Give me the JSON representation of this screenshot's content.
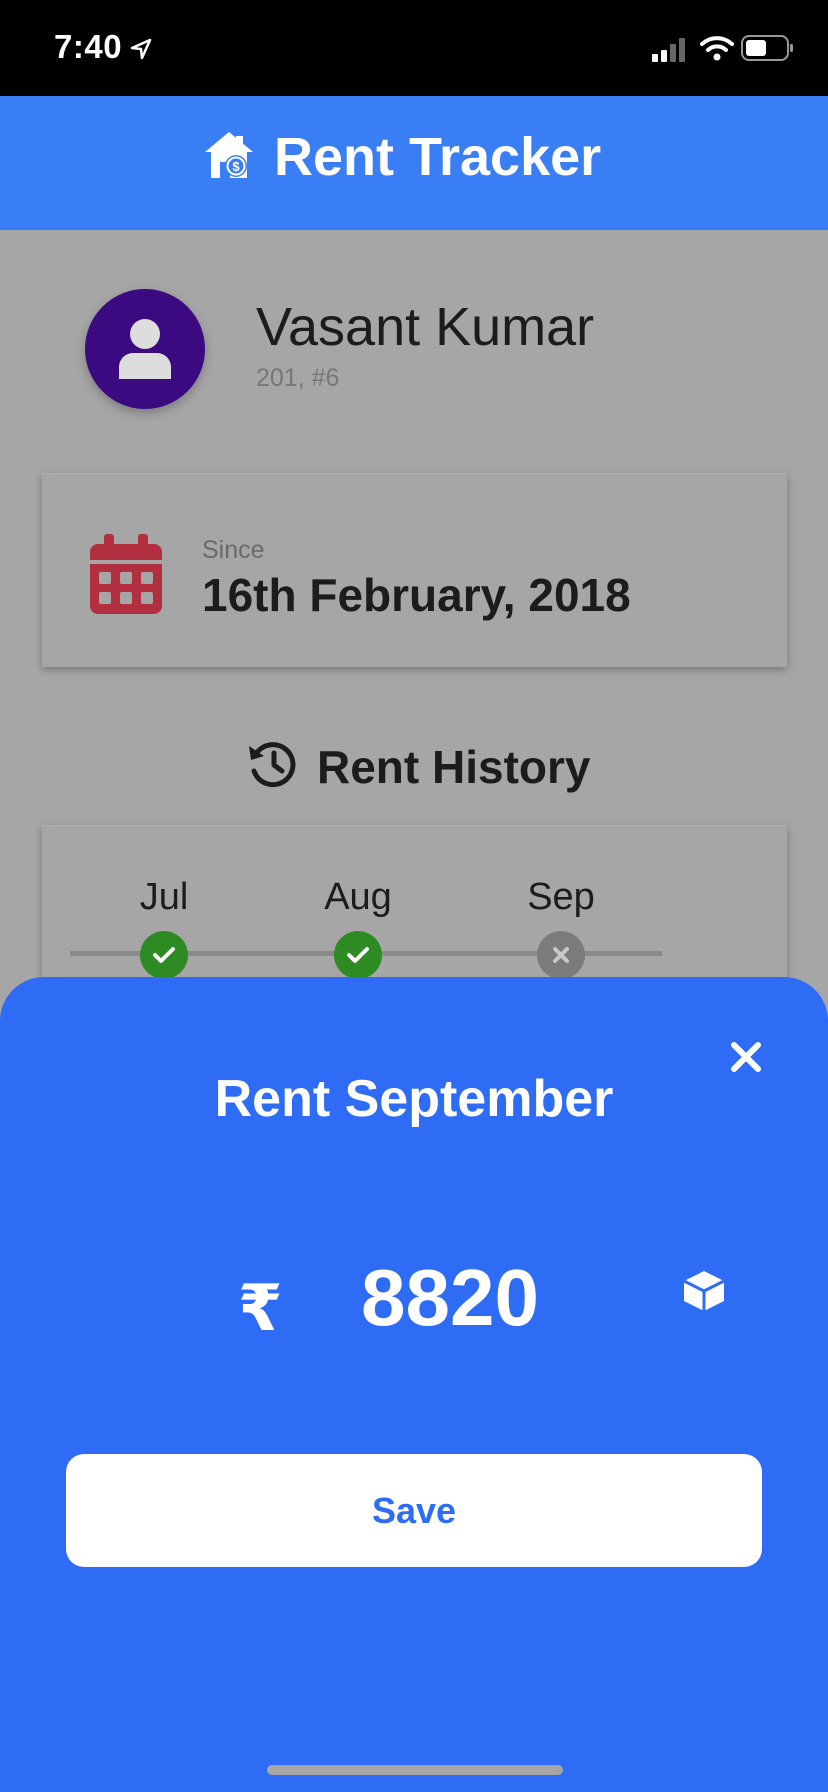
{
  "status_bar": {
    "time": "7:40"
  },
  "header": {
    "title": "Rent Tracker"
  },
  "tenant": {
    "name": "Vasant Kumar",
    "unit": "201, #6"
  },
  "since": {
    "label": "Since",
    "date": "16th February, 2018"
  },
  "history": {
    "title": "Rent History",
    "months": [
      {
        "label": "Jul",
        "status": "paid"
      },
      {
        "label": "Aug",
        "status": "paid"
      },
      {
        "label": "Sep",
        "status": "unpaid"
      }
    ]
  },
  "sheet": {
    "title": "Rent September",
    "currency_symbol": "₹",
    "amount": "8820",
    "save_label": "Save"
  },
  "colors": {
    "header": "#3a7ef6",
    "sheet": "#2f6cf6",
    "avatar": "#3b0a81",
    "calendar": "#b22f3f",
    "paid": "#2e8a22",
    "unpaid": "#7b7b7b"
  },
  "icons": {
    "header": "house-dollar-icon",
    "avatar": "user-icon",
    "since": "calendar-icon",
    "history": "history-icon",
    "close": "close-icon",
    "currency": "rupee-icon",
    "amount_action": "box-icon"
  }
}
